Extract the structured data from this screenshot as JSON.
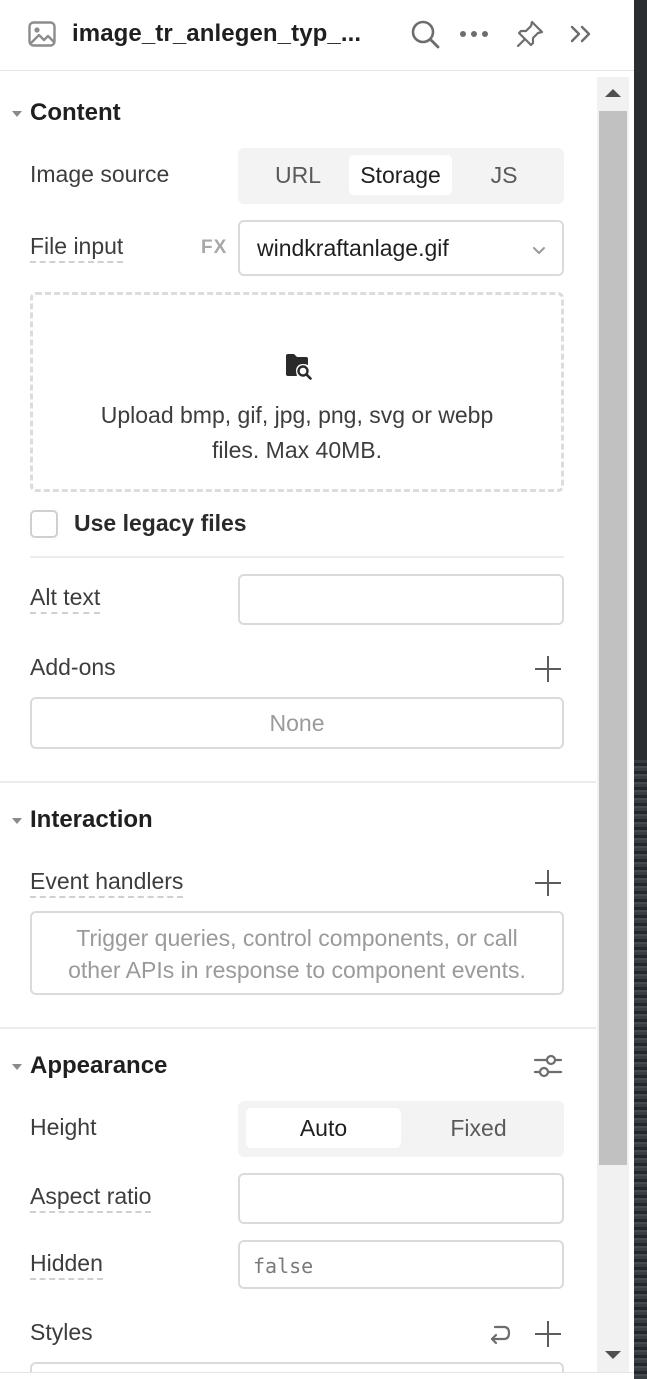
{
  "header": {
    "title": "image_tr_anlegen_typ_...",
    "icons": [
      "image-icon",
      "search-icon",
      "more-icon",
      "pin-icon",
      "collapse-icon"
    ]
  },
  "content": {
    "title": "Content",
    "image_source": {
      "label": "Image source",
      "options": [
        "URL",
        "Storage",
        "JS"
      ],
      "selected": "Storage"
    },
    "file_input": {
      "label": "File input",
      "fx": "FX",
      "value": "windkraftanlage.gif"
    },
    "upload": {
      "line1": "Upload bmp, gif, jpg, png, svg or webp",
      "line2": "files. Max 40MB."
    },
    "legacy": {
      "label": "Use legacy files",
      "checked": false
    },
    "alt_text": {
      "label": "Alt text",
      "value": ""
    },
    "addons": {
      "label": "Add-ons",
      "value": "None"
    }
  },
  "interaction": {
    "title": "Interaction",
    "event_handlers": {
      "label": "Event handlers",
      "line1": "Trigger queries, control components, or call",
      "line2": "other APIs in response to component events."
    }
  },
  "appearance": {
    "title": "Appearance",
    "height": {
      "label": "Height",
      "options": [
        "Auto",
        "Fixed"
      ],
      "selected": "Auto"
    },
    "aspect_ratio": {
      "label": "Aspect ratio",
      "value": ""
    },
    "hidden": {
      "label": "Hidden",
      "placeholder": "false"
    },
    "styles": {
      "label": "Styles"
    }
  }
}
